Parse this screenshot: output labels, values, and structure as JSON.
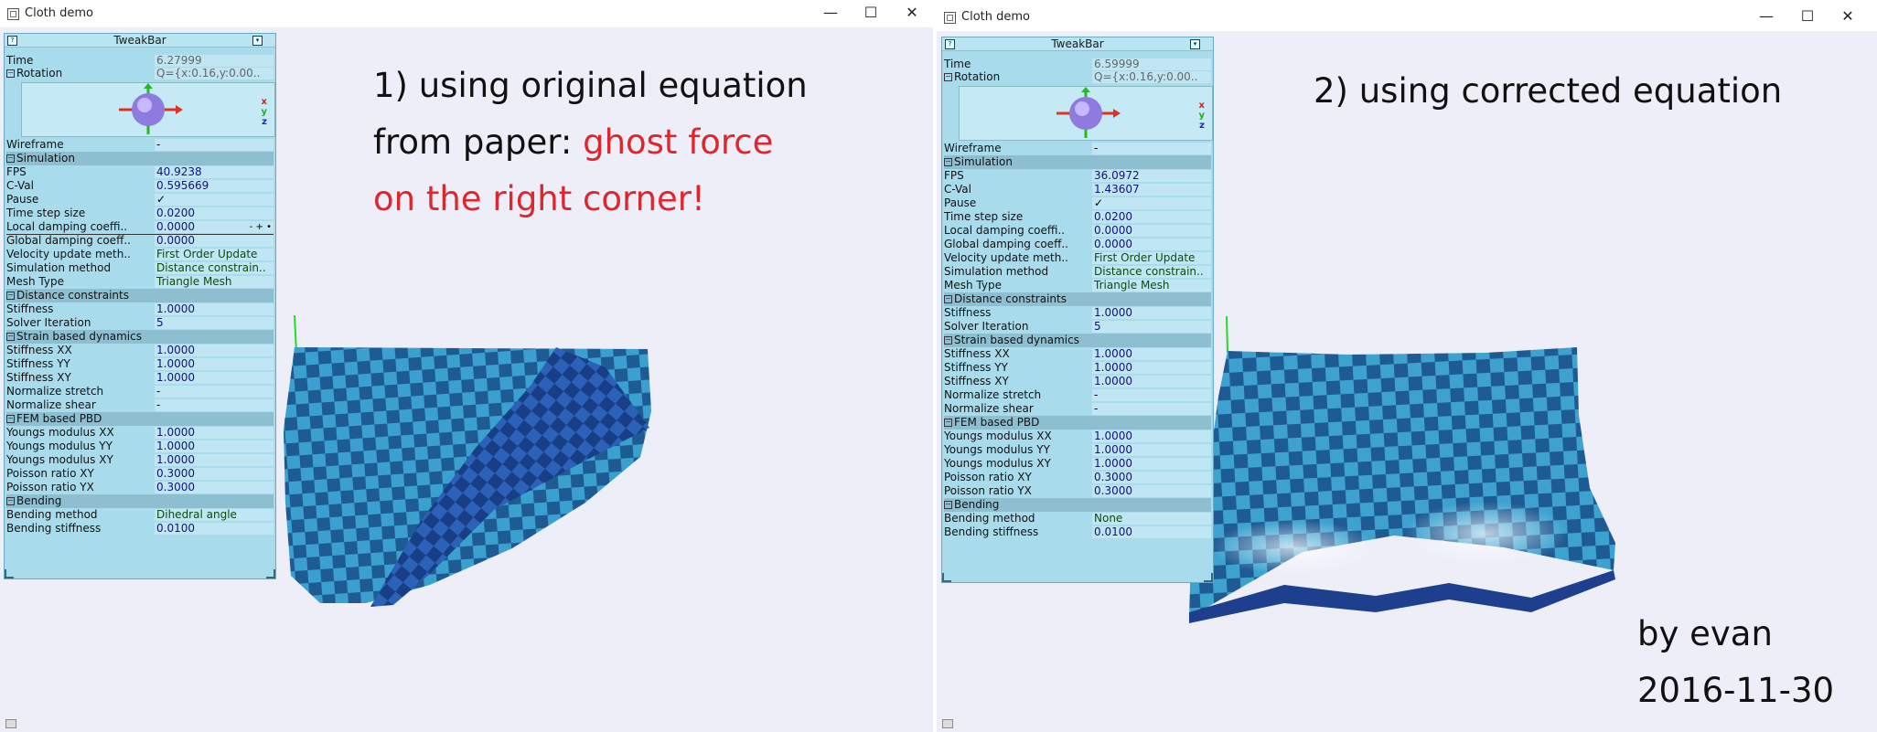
{
  "window_left": {
    "title": "Cloth demo",
    "caption": {
      "line1": "1) using original equation",
      "line2a": "from paper: ",
      "line2b": "ghost force",
      "line3": "on the right corner!"
    },
    "tweakbar": {
      "title": "TweakBar",
      "time": {
        "label": "Time",
        "value": "6.27999"
      },
      "rotation": {
        "label": "Rotation",
        "value": "Q={x:0.16,y:0.00..",
        "axes": [
          "x",
          "y",
          "z"
        ]
      },
      "wireframe": {
        "label": "Wireframe",
        "value": "-"
      },
      "simulation": {
        "label": "Simulation",
        "rows": [
          {
            "label": "FPS",
            "value": "40.9238"
          },
          {
            "label": "C-Val",
            "value": "0.595669"
          },
          {
            "label": "Pause",
            "value": "✓"
          },
          {
            "label": "Time step size",
            "value": "0.0200"
          },
          {
            "label": "Local damping coeffi..",
            "value": "0.0000",
            "extra": "- + •"
          },
          {
            "label": "Global damping coeff..",
            "value": "0.0000"
          },
          {
            "label": "Velocity update meth..",
            "value": "First Order Update"
          },
          {
            "label": "Simulation method",
            "value": "Distance constrain.."
          },
          {
            "label": "Mesh Type",
            "value": "Triangle Mesh"
          }
        ]
      },
      "distance": {
        "label": "Distance constraints",
        "rows": [
          {
            "label": "Stiffness",
            "value": "1.0000"
          },
          {
            "label": "Solver Iteration",
            "value": "5"
          }
        ]
      },
      "strain": {
        "label": "Strain based dynamics",
        "rows": [
          {
            "label": "Stiffness XX",
            "value": "1.0000"
          },
          {
            "label": "Stiffness YY",
            "value": "1.0000"
          },
          {
            "label": "Stiffness XY",
            "value": "1.0000"
          },
          {
            "label": "Normalize stretch",
            "value": "-"
          },
          {
            "label": "Normalize shear",
            "value": "-"
          }
        ]
      },
      "fem": {
        "label": "FEM based PBD",
        "rows": [
          {
            "label": "Youngs modulus XX",
            "value": "1.0000"
          },
          {
            "label": "Youngs modulus YY",
            "value": "1.0000"
          },
          {
            "label": "Youngs modulus XY",
            "value": "1.0000"
          },
          {
            "label": "Poisson ratio XY",
            "value": "0.3000"
          },
          {
            "label": "Poisson ratio YX",
            "value": "0.3000"
          }
        ]
      },
      "bending": {
        "label": "Bending",
        "rows": [
          {
            "label": "Bending method",
            "value": "Dihedral angle"
          },
          {
            "label": "Bending stiffness",
            "value": "0.0100"
          }
        ]
      }
    }
  },
  "window_right": {
    "title": "Cloth demo",
    "caption": {
      "line1": "2) using corrected equation",
      "author": "by evan",
      "date": "2016-11-30"
    },
    "tweakbar": {
      "title": "TweakBar",
      "time": {
        "label": "Time",
        "value": "6.59999"
      },
      "rotation": {
        "label": "Rotation",
        "value": "Q={x:0.16,y:0.00..",
        "axes": [
          "x",
          "y",
          "z"
        ]
      },
      "wireframe": {
        "label": "Wireframe",
        "value": "-"
      },
      "simulation": {
        "label": "Simulation",
        "rows": [
          {
            "label": "FPS",
            "value": "36.0972"
          },
          {
            "label": "C-Val",
            "value": "1.43607"
          },
          {
            "label": "Pause",
            "value": "✓"
          },
          {
            "label": "Time step size",
            "value": "0.0200"
          },
          {
            "label": "Local damping coeffi..",
            "value": "0.0000"
          },
          {
            "label": "Global damping coeff..",
            "value": "0.0000"
          },
          {
            "label": "Velocity update meth..",
            "value": "First Order Update"
          },
          {
            "label": "Simulation method",
            "value": "Distance constrain.."
          },
          {
            "label": "Mesh Type",
            "value": "Triangle Mesh"
          }
        ]
      },
      "distance": {
        "label": "Distance constraints",
        "rows": [
          {
            "label": "Stiffness",
            "value": "1.0000"
          },
          {
            "label": "Solver Iteration",
            "value": "5"
          }
        ]
      },
      "strain": {
        "label": "Strain based dynamics",
        "rows": [
          {
            "label": "Stiffness XX",
            "value": "1.0000"
          },
          {
            "label": "Stiffness YY",
            "value": "1.0000"
          },
          {
            "label": "Stiffness XY",
            "value": "1.0000"
          },
          {
            "label": "Normalize stretch",
            "value": "-"
          },
          {
            "label": "Normalize shear",
            "value": "-"
          }
        ]
      },
      "fem": {
        "label": "FEM based PBD",
        "rows": [
          {
            "label": "Youngs modulus XX",
            "value": "1.0000"
          },
          {
            "label": "Youngs modulus YY",
            "value": "1.0000"
          },
          {
            "label": "Youngs modulus XY",
            "value": "1.0000"
          },
          {
            "label": "Poisson ratio XY",
            "value": "0.3000"
          },
          {
            "label": "Poisson ratio YX",
            "value": "0.3000"
          }
        ]
      },
      "bending": {
        "label": "Bending",
        "rows": [
          {
            "label": "Bending method",
            "value": "None"
          },
          {
            "label": "Bending stiffness",
            "value": "0.0100"
          }
        ]
      }
    }
  },
  "colors": {
    "background": "#eeeef9",
    "tweakbar": "#a8dcec",
    "cloth_light": "#3aa0cf",
    "cloth_dark": "#1f4f9e",
    "highlight": "#e0262d"
  }
}
